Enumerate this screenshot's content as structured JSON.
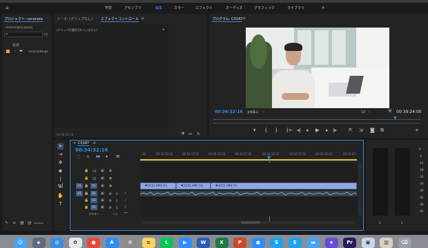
{
  "workspaces": [
    {
      "label": "学習",
      "active": false
    },
    {
      "label": "アセンブリ",
      "active": false
    },
    {
      "label": "編集",
      "active": true
    },
    {
      "label": "カラー",
      "active": false
    },
    {
      "label": "エフェクト",
      "active": false
    },
    {
      "label": "オーディオ",
      "active": false
    },
    {
      "label": "グラフィック",
      "active": false
    },
    {
      "label": "ライブラリ",
      "active": false
    }
  ],
  "workspace_more": "»",
  "project_panel": {
    "tab": "プロジェクト: cococara",
    "file": "cococaraproj.prproj",
    "search_icon": "search-icon",
    "col_name": "名前",
    "item": "cococaraHuge"
  },
  "source_panel": {
    "tab_source": "ソース: (クリップなし)",
    "tab_effect": "エフェクトコントロール",
    "no_clip": "(クリップが選択されていません)",
    "timecode": "00:34:32:16"
  },
  "program_panel": {
    "tab": "プログラム: C0187",
    "timecode": "00:34:32:16",
    "fit": "全体表示",
    "resolution": "1/2",
    "duration": "00:39:24:00"
  },
  "timeline": {
    "tab": "C0187",
    "timecode": "00:34:32:16",
    "ruler": [
      "00:34:12:22",
      "00:34:17:22",
      "00:34:22:22",
      "00:34:27:22",
      "00:34:32:22",
      "00:34:37:22",
      "00:34:42:22",
      "00:34:47"
    ],
    "ruler_start": ":22",
    "tracks_video": [
      "V3",
      "V2",
      "V1"
    ],
    "tracks_audio": [
      "A1",
      "A2",
      "A3"
    ],
    "master": "マスター",
    "master_vol": "0.0",
    "clips": [
      "C0151.MP4 [V]",
      "C0151.MP4 [V]",
      "C0151.MP4 [V]"
    ]
  },
  "meter": {
    "scale": [
      "0",
      "-6",
      "-12",
      "-18",
      "-24",
      "-30",
      "-36",
      "-42",
      "-48",
      "-54"
    ],
    "solo_labels": [
      "S",
      "S"
    ]
  },
  "dock": [
    {
      "name": "finder",
      "color": "#4aa3f0",
      "glyph": "☺"
    },
    {
      "name": "launchpad",
      "color": "#5f6b7b",
      "glyph": "◈"
    },
    {
      "name": "safari",
      "color": "#3a8fe0",
      "glyph": "◎"
    },
    {
      "name": "photos",
      "color": "#e8e8e8",
      "glyph": "✿"
    },
    {
      "name": "chrome",
      "color": "#e9473b",
      "glyph": "●"
    },
    {
      "name": "app-store",
      "color": "#2c8cf0",
      "glyph": "A"
    },
    {
      "name": "settings",
      "color": "#8c8c8c",
      "glyph": "⚙"
    },
    {
      "name": "notes",
      "color": "#f4d35e",
      "glyph": "≡"
    },
    {
      "name": "line",
      "color": "#06c755",
      "glyph": "L"
    },
    {
      "name": "zoom",
      "color": "#2d8cff",
      "glyph": "▶"
    },
    {
      "name": "word",
      "color": "#2b5cb5",
      "glyph": "W"
    },
    {
      "name": "excel",
      "color": "#1f7a45",
      "glyph": "X"
    },
    {
      "name": "powerpoint",
      "color": "#c94a2c",
      "glyph": "P"
    },
    {
      "name": "zoom-video",
      "color": "#2d8cff",
      "glyph": "◼"
    },
    {
      "name": "skype",
      "color": "#1da1f2",
      "glyph": "S"
    },
    {
      "name": "skype-2",
      "color": "#1da1f2",
      "glyph": "S"
    },
    {
      "name": "folder",
      "color": "#4aa3f0",
      "glyph": "▬"
    },
    {
      "name": "imovie",
      "color": "#6a4bd6",
      "glyph": "★"
    },
    {
      "name": "premiere",
      "color": "#2b1d5c",
      "glyph": "Pr"
    },
    {
      "name": "preview",
      "color": "#c9d8ea",
      "glyph": "▣"
    },
    {
      "name": "photo-app",
      "color": "#d8d0c2",
      "glyph": "▥"
    },
    {
      "name": "trash",
      "color": "#9aa0a8",
      "glyph": "⌫"
    }
  ]
}
